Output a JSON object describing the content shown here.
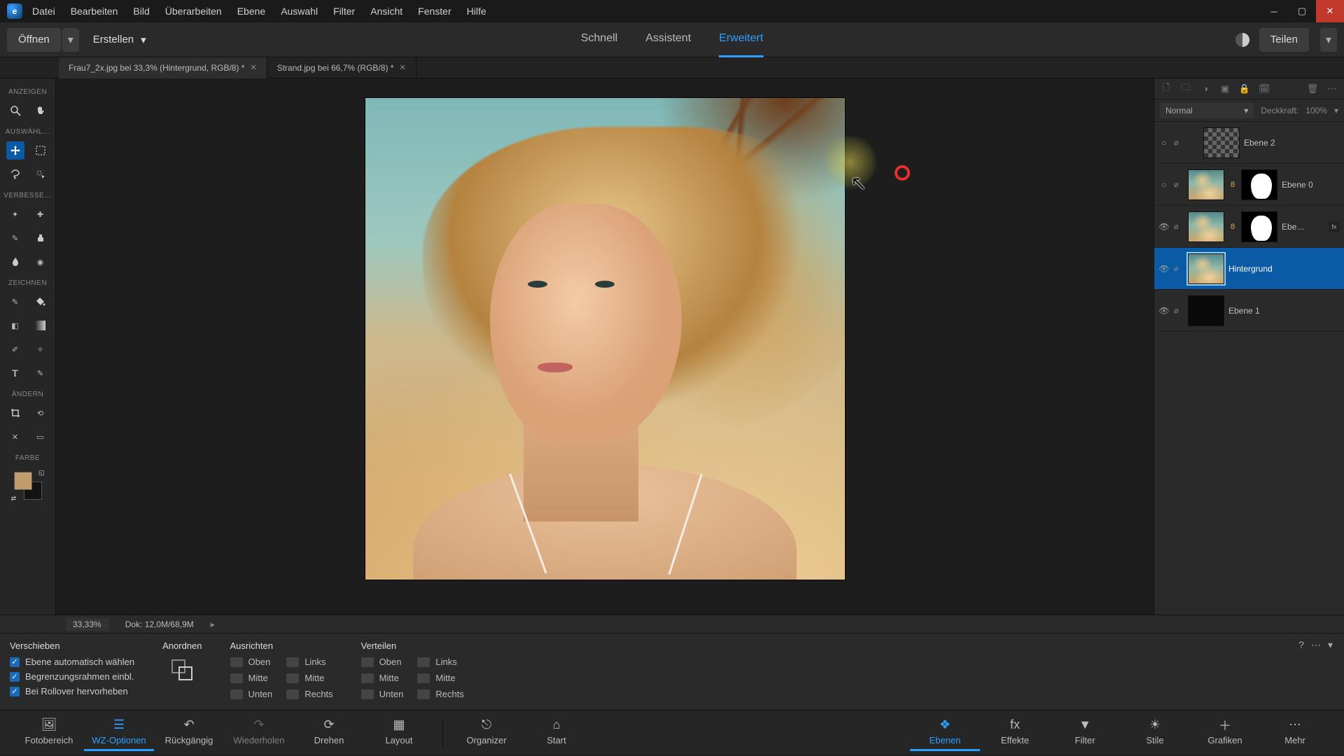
{
  "menu": [
    "Datei",
    "Bearbeiten",
    "Bild",
    "Überarbeiten",
    "Ebene",
    "Auswahl",
    "Filter",
    "Ansicht",
    "Fenster",
    "Hilfe"
  ],
  "secbar": {
    "open": "Öffnen",
    "create": "Erstellen",
    "modes": {
      "quick": "Schnell",
      "guided": "Assistent",
      "expert": "Erweitert"
    },
    "share": "Teilen"
  },
  "doctabs": [
    {
      "label": "Frau7_2x.jpg bei 33,3% (Hintergrund, RGB/8) *"
    },
    {
      "label": "Strand.jpg bei 66,7% (RGB/8) *"
    }
  ],
  "toolbox": {
    "sections": {
      "view": "ANZEIGEN",
      "select": "AUSWÄHL…",
      "enhance": "VERBESSE…",
      "draw": "ZEICHNEN",
      "modify": "ÄNDERN",
      "color": "FARBE"
    }
  },
  "status": {
    "zoom": "33,33%",
    "doc": "Dok: 12,0M/68,9M"
  },
  "options": {
    "tool": "Verschieben",
    "checks": [
      "Ebene automatisch wählen",
      "Begrenzungsrahmen einbl.",
      "Bei Rollover hervorheben"
    ],
    "anordnen": "Anordnen",
    "ausrichten": {
      "title": "Ausrichten",
      "items": [
        "Oben",
        "Links",
        "Mitte",
        "Mitte",
        "Unten",
        "Rechts"
      ]
    },
    "verteilen": {
      "title": "Verteilen",
      "items": [
        "Oben",
        "Links",
        "Mitte",
        "Mitte",
        "Unten",
        "Rechts"
      ]
    }
  },
  "layers_panel": {
    "blend_mode": "Normal",
    "opacity_label": "Deckkraft:",
    "opacity_value": "100%",
    "layers": [
      {
        "name": "Ebene 2"
      },
      {
        "name": "Ebene 0"
      },
      {
        "name": "Ebe…"
      },
      {
        "name": "Hintergrund"
      },
      {
        "name": "Ebene 1"
      }
    ]
  },
  "bottombar": {
    "left": [
      {
        "key": "fotobereich",
        "label": "Fotobereich"
      },
      {
        "key": "wzoptionen",
        "label": "WZ-Optionen"
      },
      {
        "key": "rueckgaengig",
        "label": "Rückgängig"
      },
      {
        "key": "wiederholen",
        "label": "Wiederholen"
      },
      {
        "key": "drehen",
        "label": "Drehen"
      },
      {
        "key": "layout",
        "label": "Layout"
      }
    ],
    "mid": [
      {
        "key": "organizer",
        "label": "Organizer"
      },
      {
        "key": "start",
        "label": "Start"
      }
    ],
    "right": [
      {
        "key": "ebenen",
        "label": "Ebenen"
      },
      {
        "key": "effekte",
        "label": "Effekte"
      },
      {
        "key": "filter",
        "label": "Filter"
      },
      {
        "key": "stile",
        "label": "Stile"
      },
      {
        "key": "grafiken",
        "label": "Grafiken"
      },
      {
        "key": "mehr",
        "label": "Mehr"
      }
    ]
  }
}
